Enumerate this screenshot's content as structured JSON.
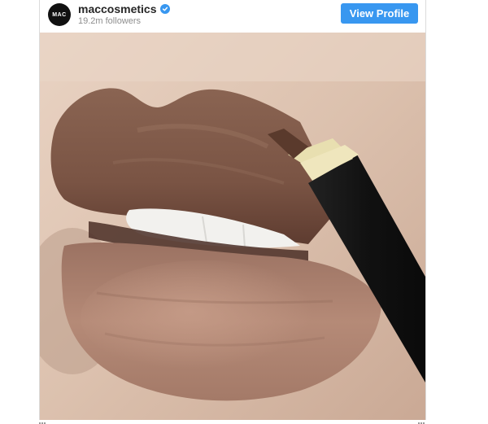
{
  "account": {
    "avatar_text": "MAC",
    "username": "maccosmetics",
    "verified_icon": "verified-badge-icon",
    "followers": "19.2m followers"
  },
  "actions": {
    "view_profile_label": "View Profile"
  },
  "post": {
    "image": "lip-liner-closeup-photo"
  },
  "colors": {
    "accent": "#3897f0",
    "text_primary": "#262626",
    "text_secondary": "#8e8e8e"
  }
}
